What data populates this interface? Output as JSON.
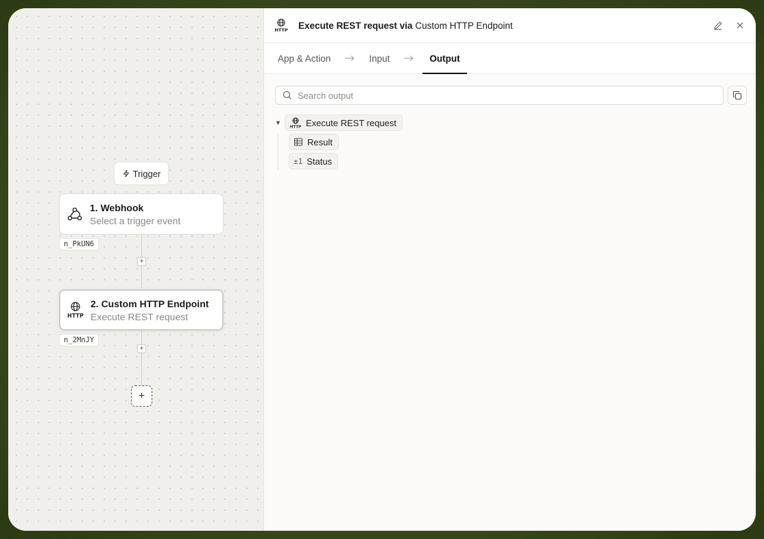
{
  "canvas": {
    "trigger_label": "Trigger",
    "nodes": [
      {
        "title": "1. Webhook",
        "subtitle": "Select a trigger event",
        "id": "n_PkUN6",
        "icon": "webhook-icon"
      },
      {
        "title": "2. Custom HTTP Endpoint",
        "subtitle": "Execute REST request",
        "id": "n_2MnJY",
        "icon": "http-globe-icon"
      }
    ],
    "add_step_label": "+"
  },
  "panel": {
    "title_bold": "Execute REST request via",
    "title_rest": "Custom HTTP Endpoint",
    "tabs": [
      {
        "label": "App & Action"
      },
      {
        "label": "Input"
      },
      {
        "label": "Output"
      }
    ],
    "active_tab": "Output",
    "search": {
      "placeholder": "Search output",
      "value": ""
    },
    "tree": {
      "root": {
        "label": "Execute REST request",
        "icon": "http-globe-icon",
        "expanded": true
      },
      "children": [
        {
          "label": "Result",
          "icon": "table-icon"
        },
        {
          "label": "Status",
          "icon_text": "±1"
        }
      ]
    }
  },
  "colors": {
    "frame_bg": "#3a4a1c",
    "canvas_bg": "#f0efec",
    "panel_bg": "#fcfbf9"
  }
}
